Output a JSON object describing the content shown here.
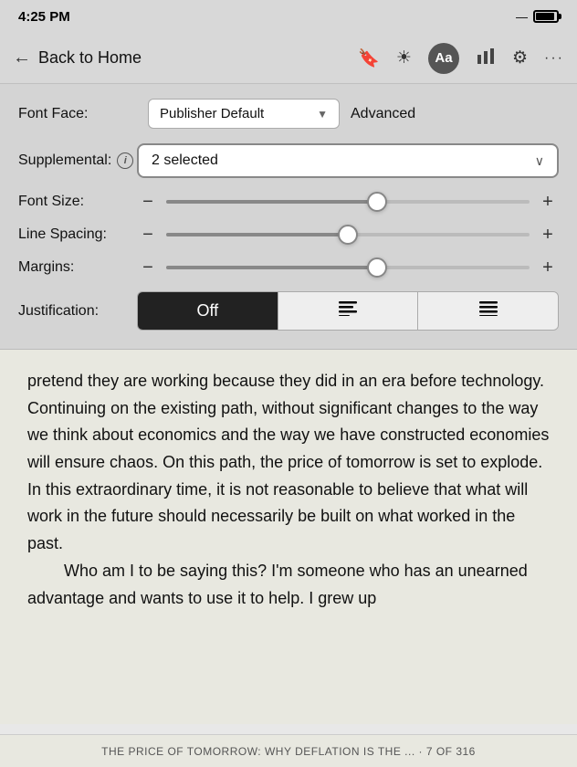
{
  "statusBar": {
    "time": "4:25 PM"
  },
  "navBar": {
    "backLabel": "Back to Home",
    "icons": {
      "bookmark": "🔖",
      "brightness": "☀",
      "aa": "Aa",
      "chart": "📊",
      "gear": "⚙",
      "more": "•••"
    }
  },
  "settings": {
    "fontFaceLabel": "Font Face:",
    "fontFaceValue": "Publisher Default",
    "advancedLabel": "Advanced",
    "supplementalLabel": "Supplemental:",
    "supplementalValue": "2 selected",
    "fontSizeLabel": "Font Size:",
    "lineSpacingLabel": "Line Spacing:",
    "marginsLabel": "Margins:",
    "justificationLabel": "Justification:",
    "justificationOptions": [
      "Off",
      "≡",
      "≡"
    ],
    "activeJustification": 0,
    "sliders": {
      "fontSize": 58,
      "lineSpacing": 50,
      "margins": 58
    }
  },
  "bookContent": {
    "paragraphs": [
      "pretend they are working because they did in an era before technology. Continuing on the existing path, without significant changes to the way we think about economics and the way we have constructed economies will ensure chaos. On this path, the price of tomorrow is set to explode. In this extraordinary time, it is not reasonable to believe that what will work in the future should necessarily be built on what worked in the past.",
      "Who am I to be saying this? I'm someone who has an unearned advantage and wants to use it to help. I grew up"
    ],
    "footer": "THE PRICE OF TOMORROW: WHY DEFLATION IS THE ... · 7 OF 316"
  }
}
